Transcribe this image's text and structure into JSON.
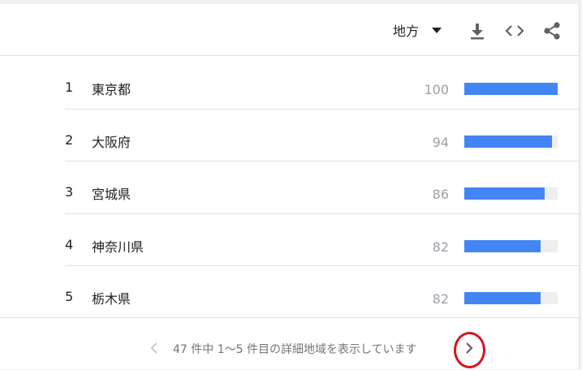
{
  "toolbar": {
    "region_label": "地方",
    "icons": [
      "chevron-down-icon",
      "download-icon",
      "embed-code-icon",
      "share-icon"
    ]
  },
  "rows": [
    {
      "rank": "1",
      "name": "東京都",
      "value": "100",
      "fraction": 1.0
    },
    {
      "rank": "2",
      "name": "大阪府",
      "value": "94",
      "fraction": 0.94
    },
    {
      "rank": "3",
      "name": "宮城県",
      "value": "86",
      "fraction": 0.86
    },
    {
      "rank": "4",
      "name": "神奈川県",
      "value": "82",
      "fraction": 0.82
    },
    {
      "rank": "5",
      "name": "栃木県",
      "value": "82",
      "fraction": 0.82
    }
  ],
  "footer": {
    "pager_text": "47 件中 1〜5 件目の詳細地域を表示しています"
  },
  "colors": {
    "bar": "#4285f4",
    "bar_track": "#eeeeee",
    "highlight": "#d8131e"
  }
}
